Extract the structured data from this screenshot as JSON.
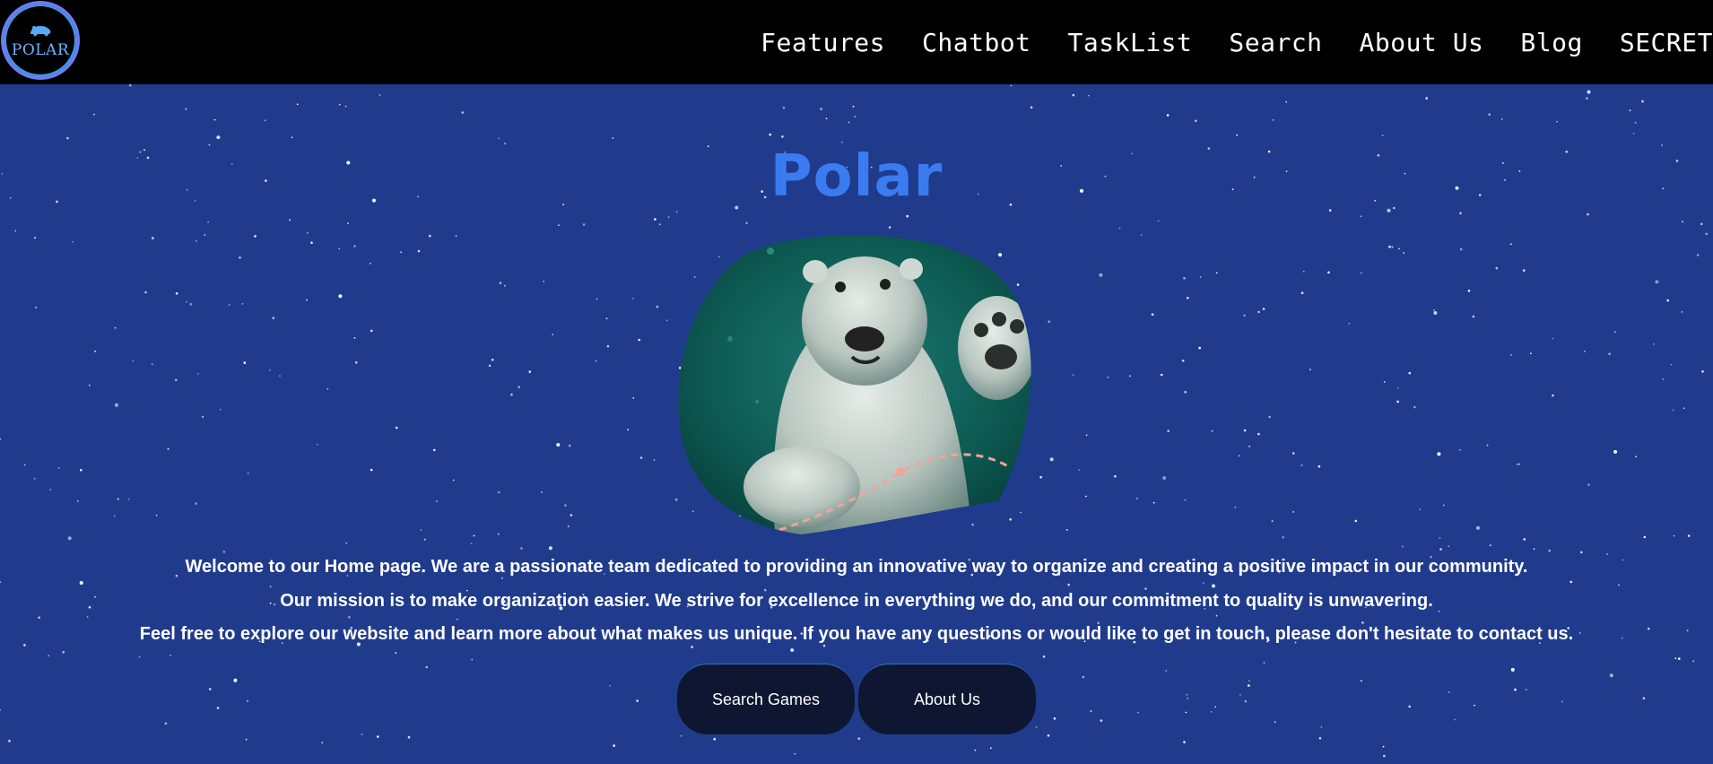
{
  "brand": {
    "logo_text": "POLAR"
  },
  "nav": {
    "items": [
      {
        "label": "Features"
      },
      {
        "label": "Chatbot"
      },
      {
        "label": "TaskList"
      },
      {
        "label": "Search"
      },
      {
        "label": "About Us"
      },
      {
        "label": "Blog"
      },
      {
        "label": "SECRET"
      }
    ]
  },
  "hero": {
    "title": "Polar"
  },
  "description": {
    "line1": "Welcome to our Home page. We are a passionate team dedicated to providing an innovative way to organize and creating a positive impact in our community.",
    "line2": "Our mission is to make organization easier. We strive for excellence in everything we do, and our commitment to quality is unwavering.",
    "line3": "Feel free to explore our website and learn more about what makes us unique. If you have any questions or would like to get in touch, please don't hesitate to contact us."
  },
  "buttons": {
    "search_games": "Search Games",
    "about_us": "About Us"
  },
  "colors": {
    "background": "#203b8c",
    "navbar": "#000000",
    "title": "#3a7cf0",
    "button": "#0e1631",
    "logo_ring": "#6a7cf5"
  }
}
